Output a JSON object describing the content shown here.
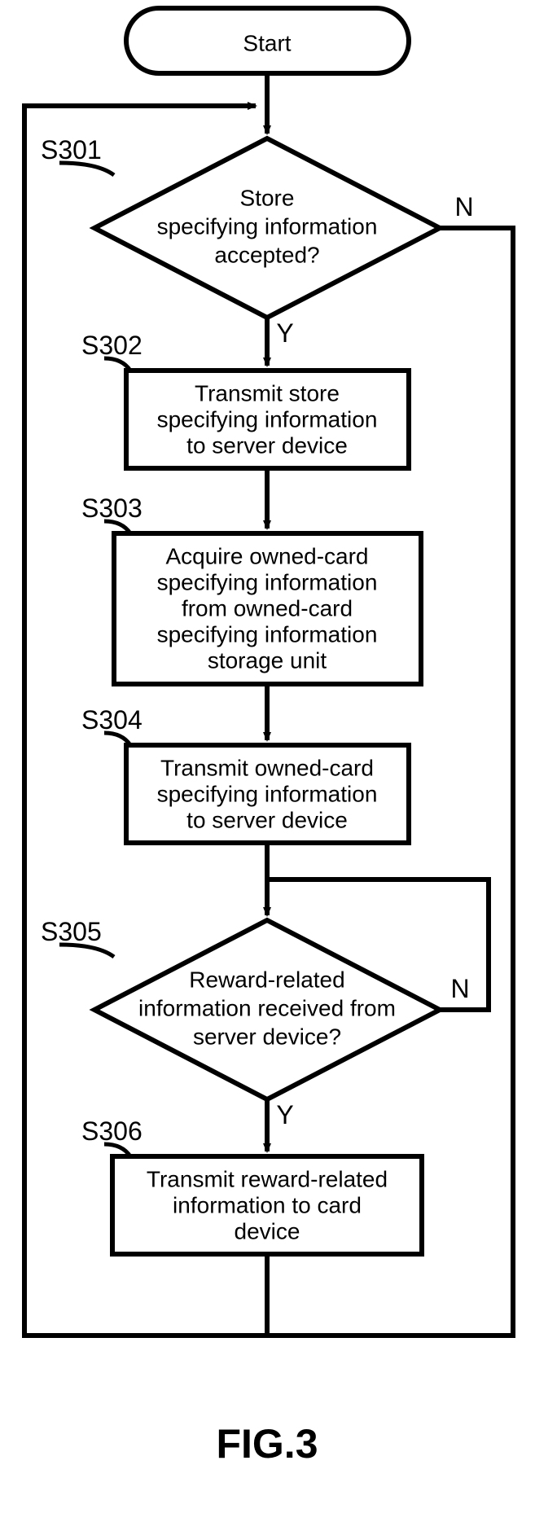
{
  "terminator": {
    "start": "Start"
  },
  "steps": {
    "s301": {
      "label": "S301",
      "lines": [
        "Store",
        "specifying information",
        "accepted?"
      ]
    },
    "s302": {
      "label": "S302",
      "lines": [
        "Transmit store",
        "specifying information",
        "to server device"
      ]
    },
    "s303": {
      "label": "S303",
      "lines": [
        "Acquire owned-card",
        "specifying information",
        "from owned-card",
        "specifying information",
        "storage unit"
      ]
    },
    "s304": {
      "label": "S304",
      "lines": [
        "Transmit owned-card",
        "specifying information",
        "to server device"
      ]
    },
    "s305": {
      "label": "S305",
      "lines": [
        "Reward-related",
        "information received from",
        "server device?"
      ]
    },
    "s306": {
      "label": "S306",
      "lines": [
        "Transmit reward-related",
        "information to card",
        "device"
      ]
    }
  },
  "branches": {
    "yes": "Y",
    "no": "N"
  },
  "caption": "FIG.3"
}
